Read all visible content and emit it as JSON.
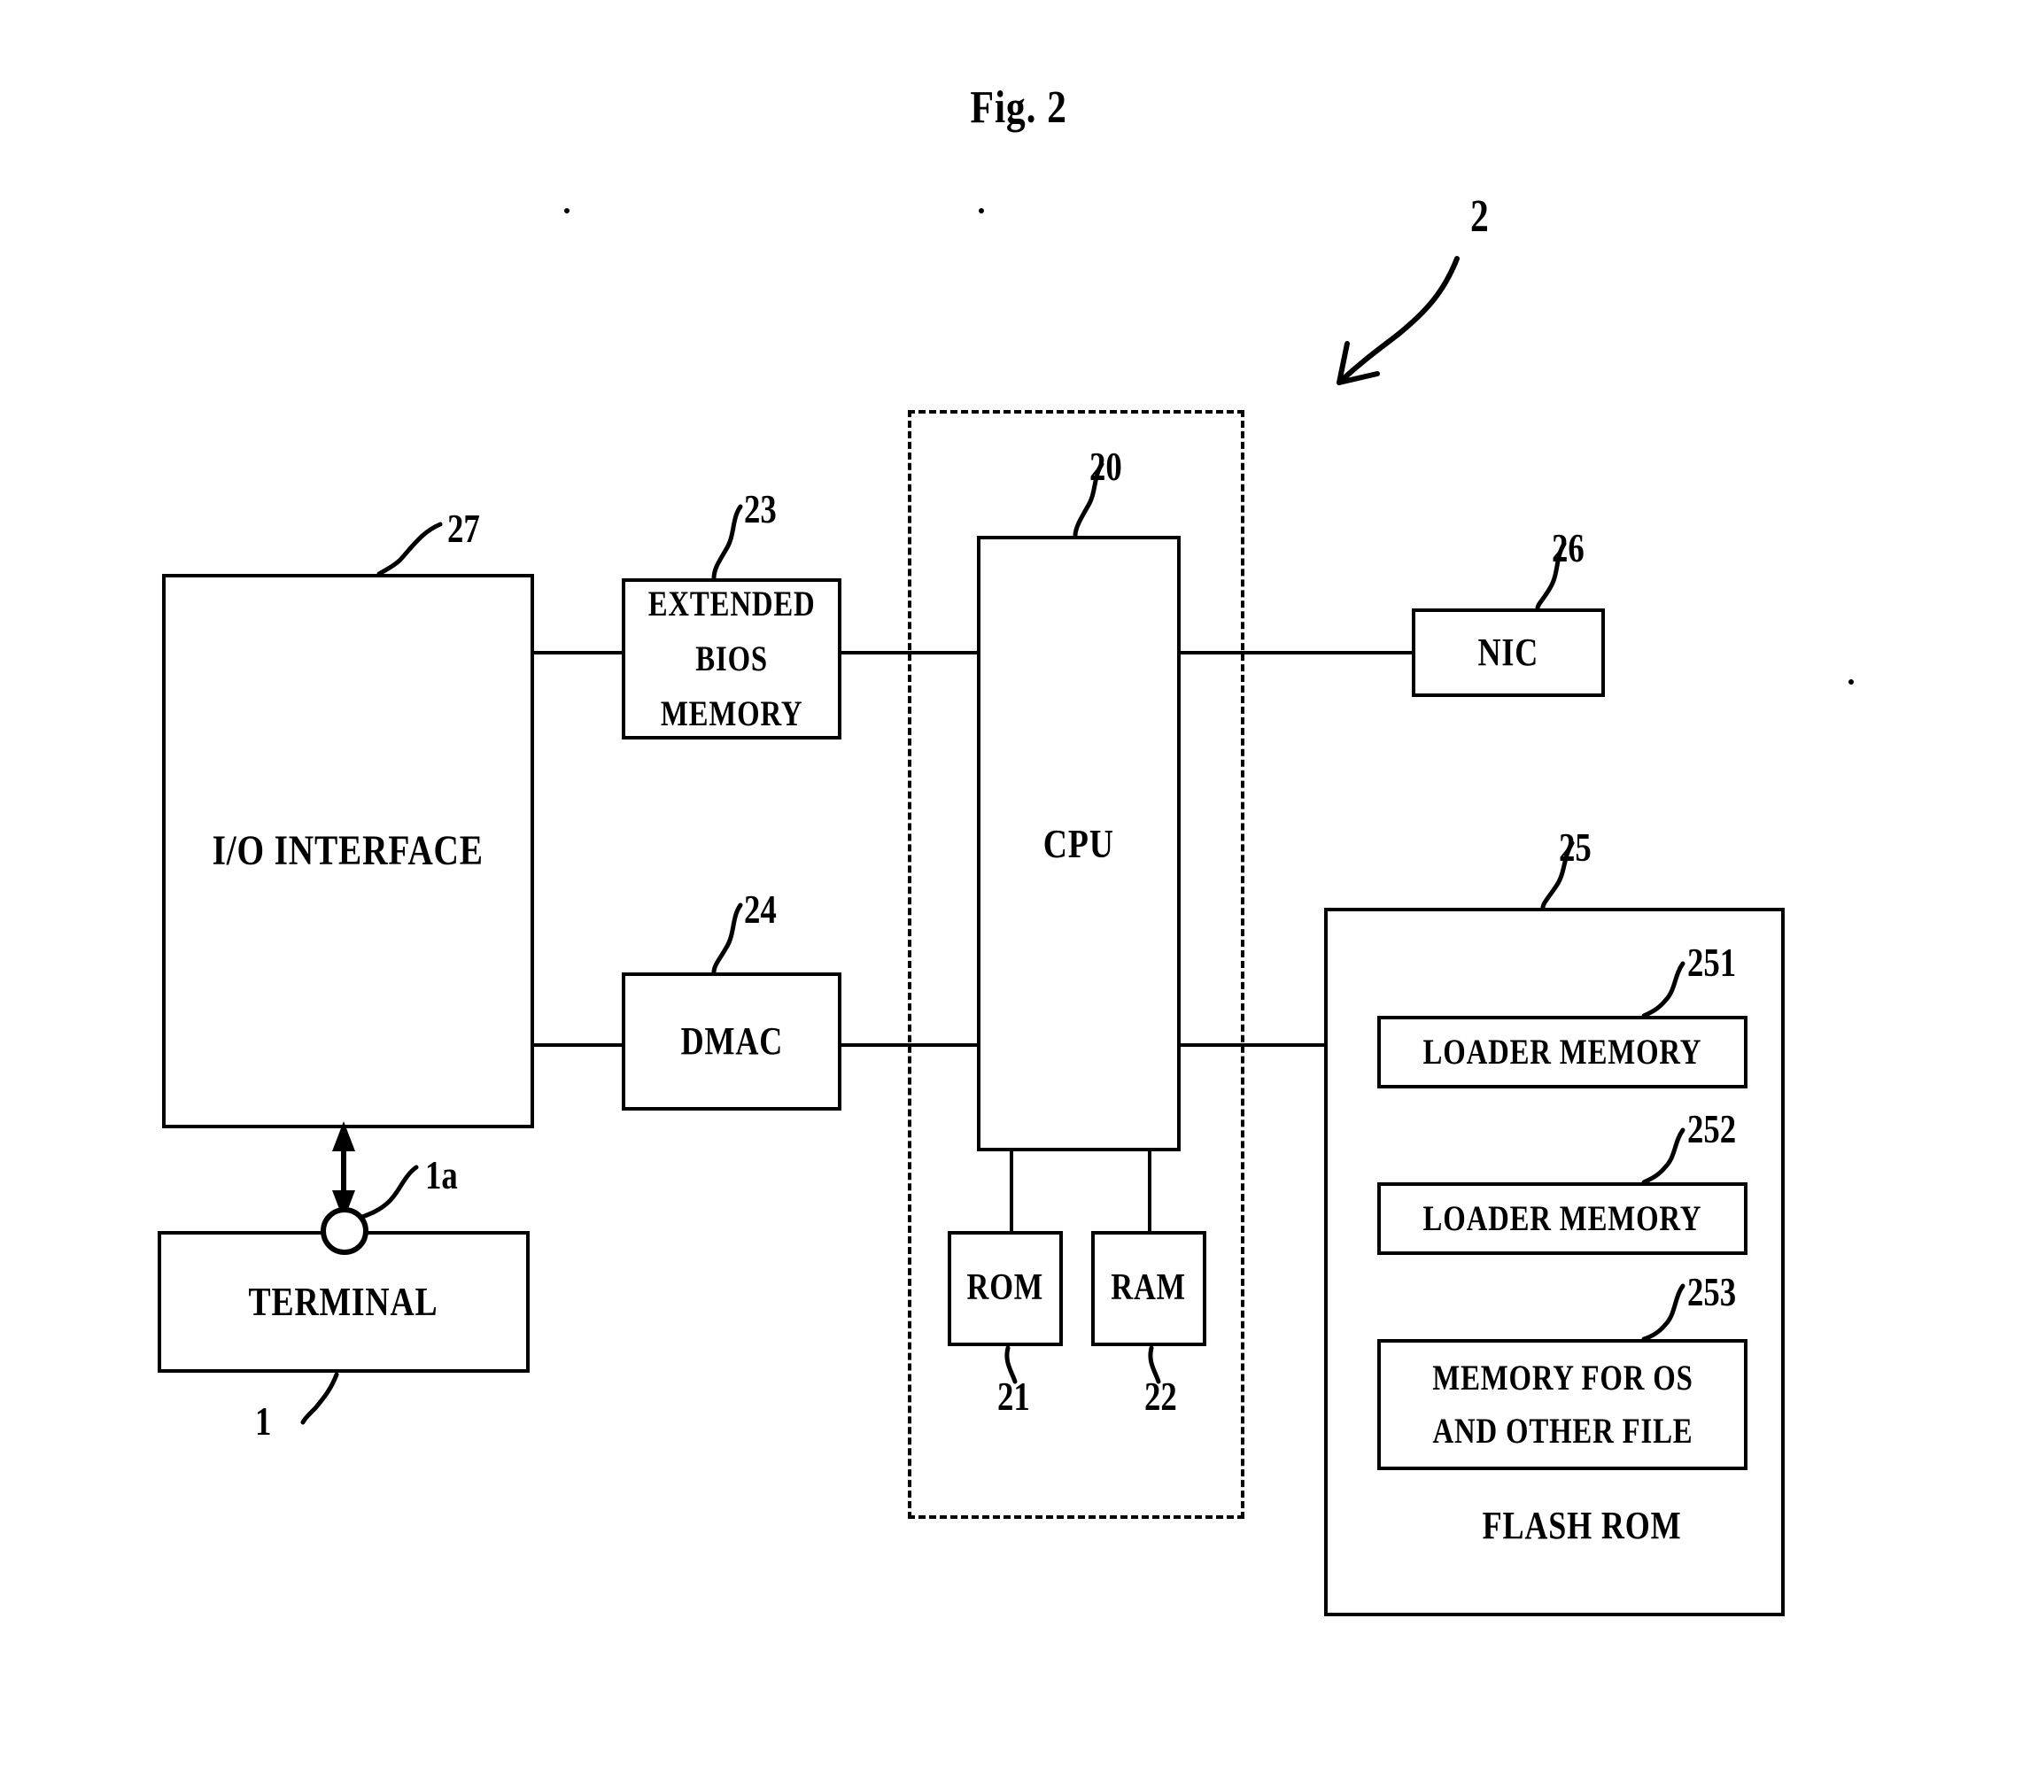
{
  "figure": {
    "title": "Fig. 2",
    "overall_ref": "2"
  },
  "blocks": {
    "io_interface": {
      "label": "I/O INTERFACE",
      "ref": "27"
    },
    "terminal": {
      "label": "TERMINAL",
      "ref": "1"
    },
    "coupling": {
      "ref": "1a"
    },
    "extended_bios_memory": {
      "label": "EXTENDED\nBIOS\nMEMORY",
      "ref": "23"
    },
    "dmac": {
      "label": "DMAC",
      "ref": "24"
    },
    "cpu": {
      "label": "CPU",
      "ref": "20"
    },
    "rom": {
      "label": "ROM",
      "ref": "21"
    },
    "ram": {
      "label": "RAM",
      "ref": "22"
    },
    "nic": {
      "label": "NIC",
      "ref": "26"
    },
    "flash_rom": {
      "label": "FLASH ROM",
      "ref": "25"
    },
    "loader_memory_1": {
      "label": "LOADER MEMORY",
      "ref": "251"
    },
    "loader_memory_2": {
      "label": "LOADER MEMORY",
      "ref": "252"
    },
    "memory_for_os": {
      "label": "MEMORY FOR OS\nAND OTHER FILE",
      "ref": "253"
    }
  },
  "colors": {
    "ink": "#000000",
    "paper": "#ffffff"
  }
}
